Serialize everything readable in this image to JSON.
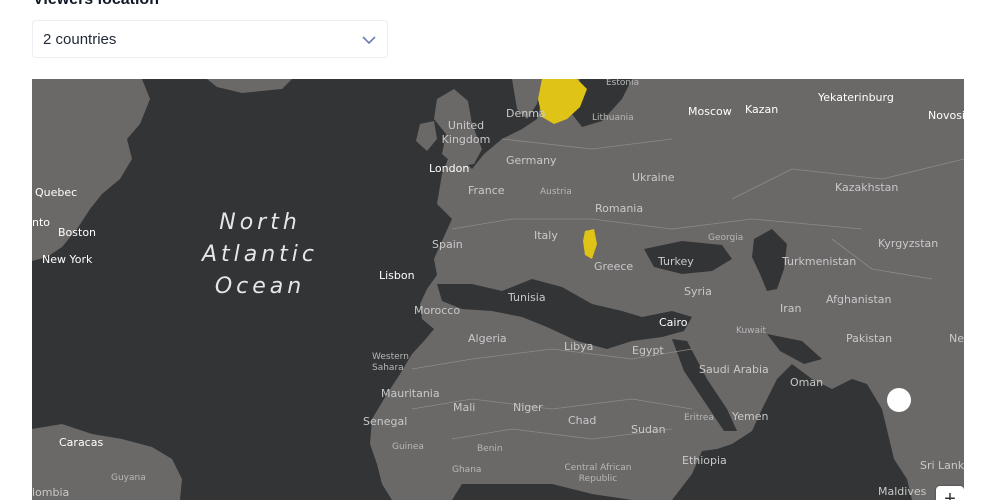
{
  "heading": "Viewers location",
  "select": {
    "value": "2 countries",
    "icon": "chevron-down-icon"
  },
  "map": {
    "ocean": [
      "North",
      "Atlantic",
      "Ocean"
    ],
    "highlight_color": "#e0c317",
    "labels": {
      "estonia": "Estonia",
      "moscow": "Moscow",
      "kazan": "Kazan",
      "yekaterinburg": "Yekaterinburg",
      "novosibirsk": "Novosi",
      "denmark": "Denma",
      "lithuania": "Lithuania",
      "united_kingdom": "United Kingdom",
      "london": "London",
      "germany": "Germany",
      "france": "France",
      "austria": "Austria",
      "ukraine": "Ukraine",
      "kazakhstan": "Kazakhstan",
      "quebec": "Quebec",
      "toronto": "nto",
      "boston": "Boston",
      "new_york": "New York",
      "spain": "Spain",
      "italy": "Italy",
      "romania": "Romania",
      "georgia": "Georgia",
      "kyrgyzstan": "Kyrgyzstan",
      "lisbon": "Lisbon",
      "greece": "Greece",
      "turkey": "Turkey",
      "turkmenistan": "Turkmenistan",
      "tunisia": "Tunisia",
      "syria": "Syria",
      "iran": "Iran",
      "afghanistan": "Afghanistan",
      "morocco": "Morocco",
      "cairo": "Cairo",
      "kuwait": "Kuwait",
      "pakistan": "Pakistan",
      "nepal": "Ne",
      "algeria": "Algeria",
      "libya": "Libya",
      "egypt": "Egypt",
      "western_sahara": "Western Sahara",
      "saudi_arabia": "Saudi Arabia",
      "oman": "Oman",
      "mauritania": "Mauritania",
      "mali": "Mali",
      "niger": "Niger",
      "eritrea": "Eritrea",
      "yemen": "Yemen",
      "senegal": "Senegal",
      "chad": "Chad",
      "sudan": "Sudan",
      "caracas": "Caracas",
      "guinea": "Guinea",
      "benin": "Benin",
      "ethiopia": "Ethiopia",
      "sri_lanka": "Sri Lank",
      "guyana": "Guyana",
      "ghana": "Ghana",
      "car": "Central African Republic",
      "maldives": "Maldives",
      "colombia": "lombia"
    },
    "zoom_in": "+"
  }
}
